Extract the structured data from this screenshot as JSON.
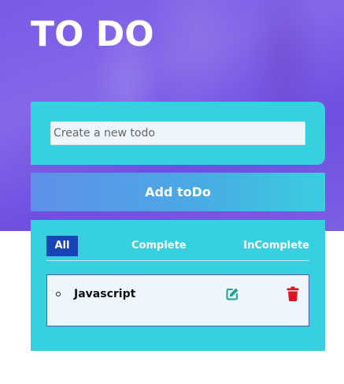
{
  "app": {
    "title": "TO DO"
  },
  "input": {
    "placeholder": "Create a new todo",
    "value": ""
  },
  "add_button": {
    "label": "Add toDo"
  },
  "tabs": [
    {
      "label": "All",
      "active": true
    },
    {
      "label": "Complete",
      "active": false
    },
    {
      "label": "InComplete",
      "active": false
    }
  ],
  "todos": [
    {
      "text": "Javascript",
      "edit_icon": "edit-icon",
      "delete_icon": "trash-icon"
    }
  ],
  "colors": {
    "accent": "#37d0df",
    "active_tab": "#1845b6",
    "edit_icon": "#1ba39a",
    "delete_icon": "#e0141e"
  }
}
